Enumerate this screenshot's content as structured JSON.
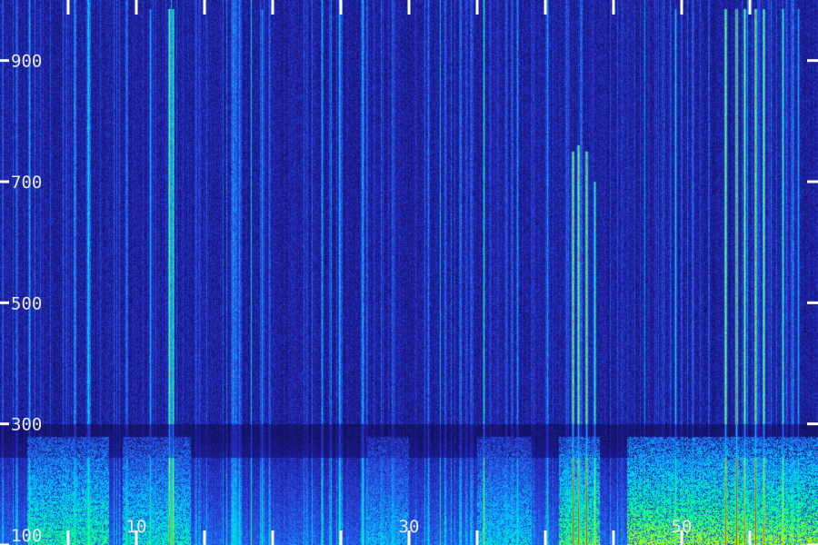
{
  "chart_data": {
    "type": "heatmap",
    "title": "",
    "xlabel": "",
    "ylabel": "",
    "x_range": [
      0,
      60
    ],
    "y_range": [
      100,
      1000
    ],
    "x_ticks": [
      {
        "value": 10,
        "label": "10"
      },
      {
        "value": 30,
        "label": "30"
      },
      {
        "value": 50,
        "label": "50"
      }
    ],
    "y_ticks": [
      {
        "value": 100,
        "label": "100"
      },
      {
        "value": 300,
        "label": "300"
      },
      {
        "value": 500,
        "label": "500"
      },
      {
        "value": 700,
        "label": "700"
      },
      {
        "value": 900,
        "label": "900"
      }
    ],
    "x_minor_ticks": [
      5,
      10,
      15,
      20,
      25,
      30,
      35,
      40,
      45,
      50,
      55
    ],
    "colormap": [
      "#0a0a32",
      "#1e1ea0",
      "#2850e6",
      "#00c8ff",
      "#00ff96",
      "#c8ff00",
      "#ff3200"
    ],
    "bright_bands": [
      {
        "x": 12.4,
        "y_top": 985,
        "intensity": 0.78
      },
      {
        "x": 12.7,
        "y_top": 985,
        "intensity": 0.72
      },
      {
        "x": 11.0,
        "y_top": 985,
        "intensity": 0.5
      },
      {
        "x": 19.2,
        "y_top": 985,
        "intensity": 0.45
      },
      {
        "x": 42.0,
        "y_top": 750,
        "intensity": 0.9
      },
      {
        "x": 42.4,
        "y_top": 760,
        "intensity": 0.85
      },
      {
        "x": 43.0,
        "y_top": 750,
        "intensity": 0.9
      },
      {
        "x": 43.6,
        "y_top": 700,
        "intensity": 0.7
      },
      {
        "x": 49.5,
        "y_top": 985,
        "intensity": 0.55
      },
      {
        "x": 53.2,
        "y_top": 985,
        "intensity": 0.85
      },
      {
        "x": 54.0,
        "y_top": 985,
        "intensity": 0.95
      },
      {
        "x": 54.6,
        "y_top": 985,
        "intensity": 0.8
      },
      {
        "x": 55.4,
        "y_top": 985,
        "intensity": 0.9
      },
      {
        "x": 56.0,
        "y_top": 985,
        "intensity": 0.8
      },
      {
        "x": 57.4,
        "y_top": 985,
        "intensity": 0.7
      },
      {
        "x": 58.5,
        "y_top": 985,
        "intensity": 0.5
      }
    ],
    "dark_band_y": [
      245,
      300
    ]
  }
}
